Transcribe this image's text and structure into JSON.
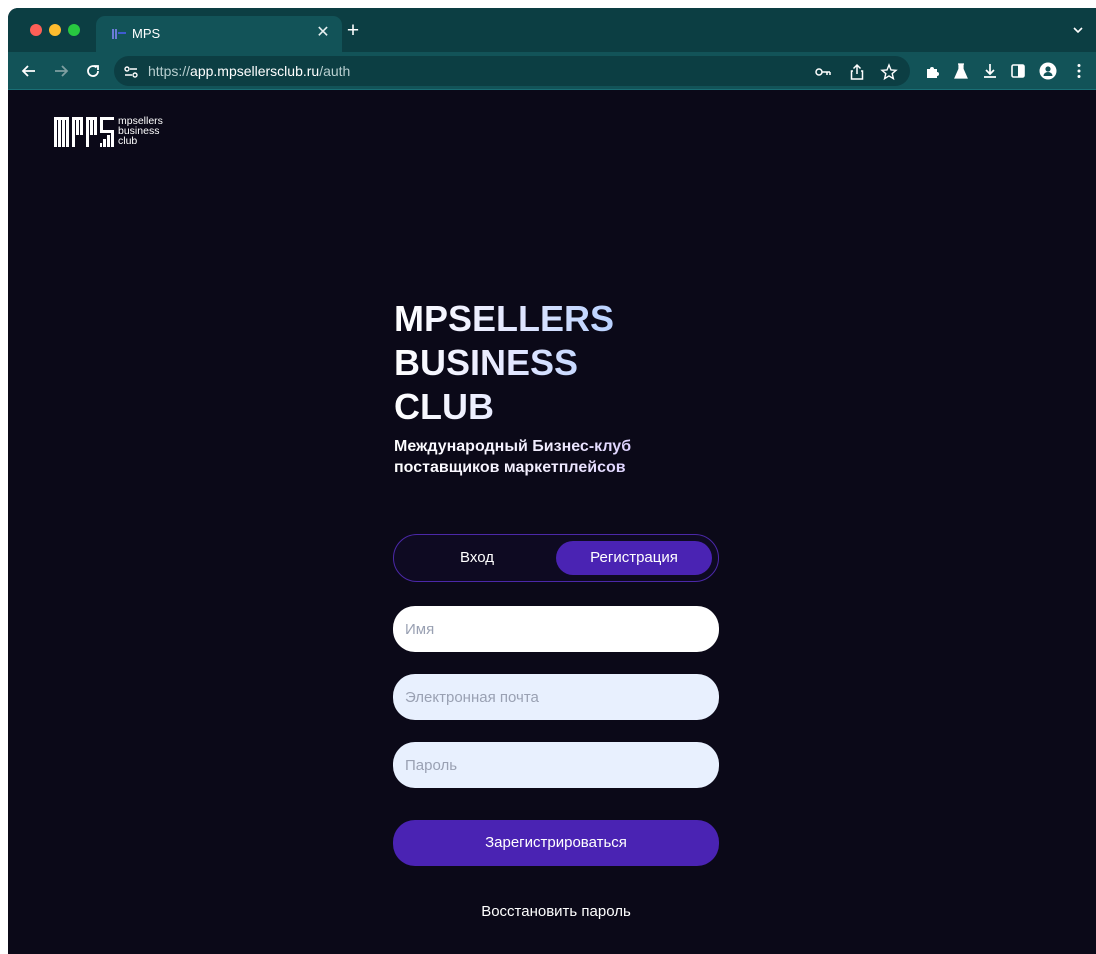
{
  "browser": {
    "tab_title": "MPS",
    "url_scheme": "https://",
    "url_host": "app.mpsellersclub.ru",
    "url_path": "/auth"
  },
  "logo": {
    "line1": "mpsellers",
    "line2": "business",
    "line3": "club"
  },
  "hero": {
    "title_line1": "MPSELLERS",
    "title_line2": "BUSINESS",
    "title_line3": "CLUB",
    "subtitle_line1": "Международный Бизнес-клуб",
    "subtitle_line2": "поставщиков маркетплейсов"
  },
  "auth": {
    "tab_login": "Вход",
    "tab_register": "Регистрация",
    "active_tab": "Регистрация",
    "name_placeholder": "Имя",
    "email_placeholder": "Электронная почта",
    "password_placeholder": "Пароль",
    "submit_label": "Зарегистрироваться",
    "restore_label": "Восстановить пароль"
  },
  "colors": {
    "page_bg": "#0b0918",
    "accent": "#4a23b3",
    "browser_frame": "#0c3e43"
  }
}
